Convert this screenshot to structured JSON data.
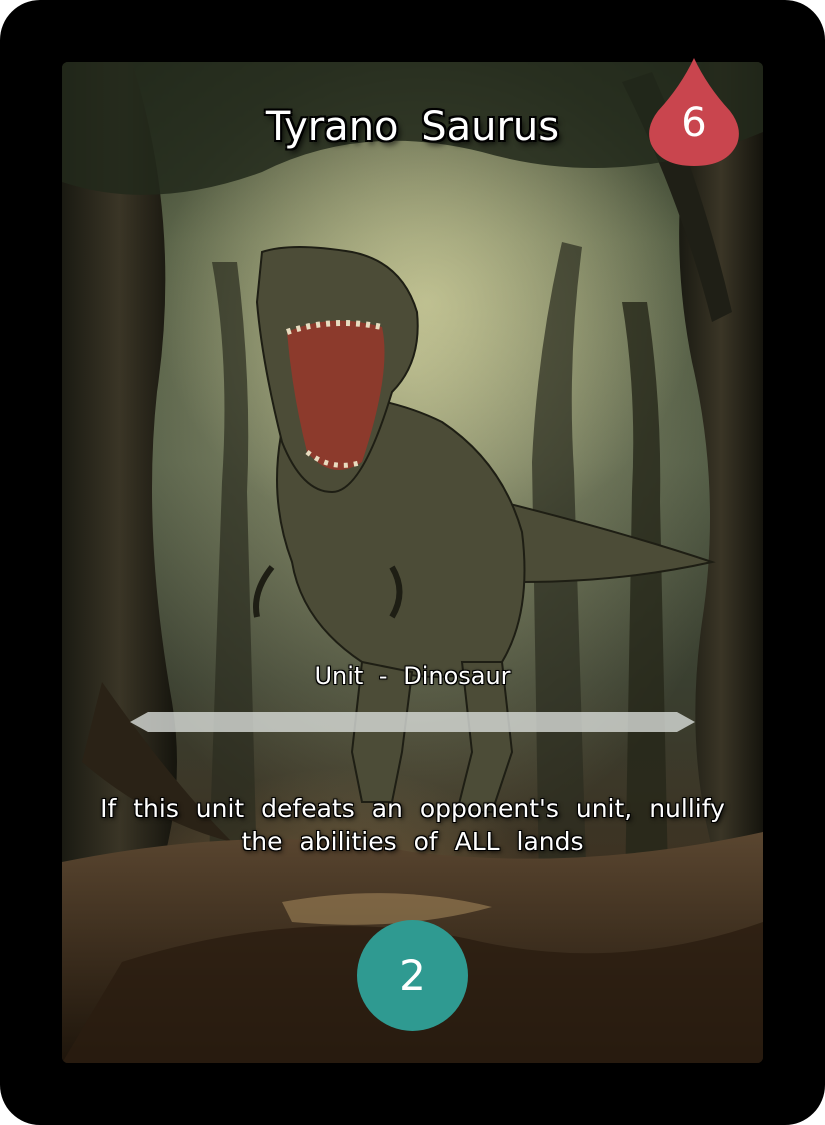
{
  "card": {
    "name": "Tyrano Saurus",
    "cost": "6",
    "type_line": "Unit - Dinosaur",
    "ability": "If this unit defeats an opponent's unit, nullify the abilities of ALL lands",
    "power": "2"
  },
  "colors": {
    "cost_drop": "#c9454e",
    "power_circle": "#2f9a91",
    "frame": "#000000"
  },
  "art": {
    "subject": "tyrannosaurus-roaring-in-forest"
  }
}
